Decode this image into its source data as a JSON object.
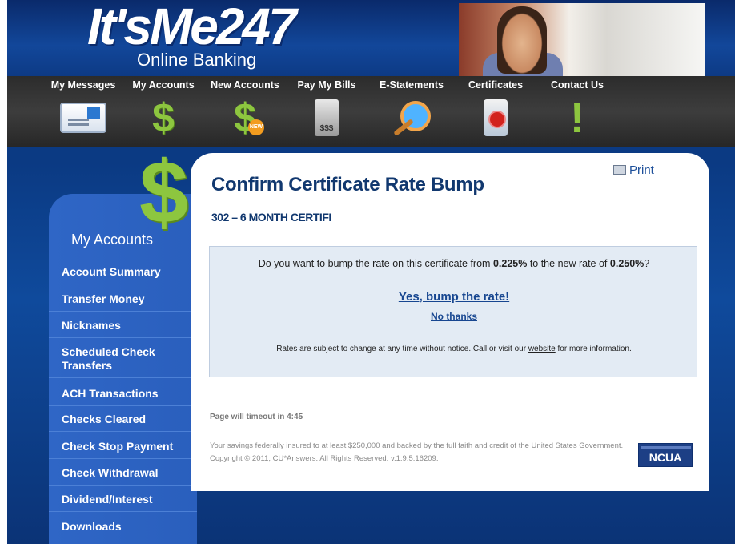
{
  "brand": {
    "logo": "It'sMe247",
    "sub": "Online Banking"
  },
  "nav": [
    {
      "label": "My Messages",
      "icon": "envelope-icon"
    },
    {
      "label": "My Accounts",
      "icon": "dollar-icon"
    },
    {
      "label": "New Accounts",
      "icon": "dollar-new-icon",
      "badge": "NEW"
    },
    {
      "label": "Pay My Bills",
      "icon": "bill-icon",
      "glyph": "$$$"
    },
    {
      "label": "E-Statements",
      "icon": "magnifier-icon"
    },
    {
      "label": "Certificates",
      "icon": "certificate-icon"
    },
    {
      "label": "Contact Us",
      "icon": "exclamation-icon"
    }
  ],
  "sidebar": {
    "title": "My Accounts",
    "items": [
      {
        "label": "Account Summary"
      },
      {
        "label": "Transfer Money"
      },
      {
        "label": "Nicknames"
      },
      {
        "label": "Scheduled Check Transfers"
      },
      {
        "label": "ACH Transactions"
      },
      {
        "label": "Checks Cleared"
      },
      {
        "label": "Check Stop Payment"
      },
      {
        "label": "Check Withdrawal"
      },
      {
        "label": "Dividend/Interest"
      },
      {
        "label": "Downloads"
      }
    ]
  },
  "main": {
    "title": "Confirm Certificate Rate Bump",
    "print_label": "Print",
    "account": "302 – 6 MONTH CERTIFI",
    "question_pre": "Do you want to bump the rate on this certificate from ",
    "rate_from": "0.225%",
    "question_mid": " to the new rate of ",
    "rate_to": "0.250%",
    "question_post": "?",
    "yes_label": "Yes, bump the rate!",
    "no_label": "No thanks",
    "disclaimer_pre": "Rates are subject to change at any time without notice. Call or visit our ",
    "disclaimer_link": "website",
    "disclaimer_post": " for more information.",
    "timeout": "Page will timeout in 4:45",
    "footer": "Your savings federally insured to at least $250,000 and backed by the full faith and credit of the United States Government. Copyright © 2011, CU*Answers. All Rights Reserved. v.1.9.5.16209.",
    "ncua_label": "NCUA"
  },
  "colors": {
    "header_blue": "#0d3c86",
    "nav_dark": "#333333",
    "accent_green": "#8dc63f",
    "title_navy": "#11386f",
    "link_blue": "#174690"
  }
}
